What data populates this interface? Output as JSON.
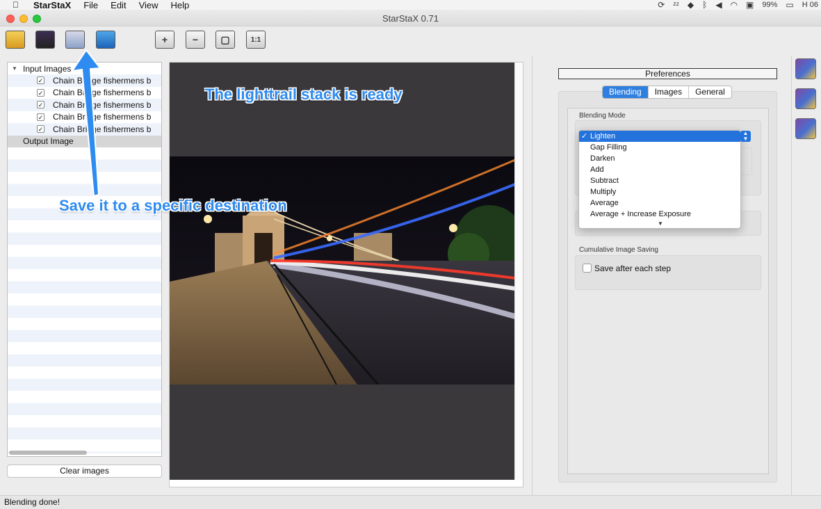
{
  "menubar": {
    "app_name": "StarStaX",
    "items": [
      "File",
      "Edit",
      "View",
      "Help"
    ],
    "battery": "99%",
    "clock": "H 06"
  },
  "window": {
    "title": "StarStaX 0.71"
  },
  "toolbar": {
    "buttons": [
      {
        "name": "open-images-button",
        "glyph": ""
      },
      {
        "name": "open-dark-frames-button",
        "glyph": ""
      },
      {
        "name": "save-image-button",
        "glyph": ""
      },
      {
        "name": "save-as-button",
        "glyph": ""
      },
      {
        "name": "zoom-in-button",
        "glyph": "+"
      },
      {
        "name": "zoom-out-button",
        "glyph": "−"
      },
      {
        "name": "fit-window-button",
        "glyph": "▢"
      },
      {
        "name": "actual-size-button",
        "glyph": "1:1"
      }
    ]
  },
  "tree": {
    "root_label": "Input Images",
    "items": [
      "Chain Bridge fishermens b",
      "Chain Bridge fishermens b",
      "Chain Bridge fishermens b",
      "Chain Bridge fishermens b",
      "Chain Bridge fishermens b"
    ],
    "output_label": "Output Image"
  },
  "clear_button": "Clear images",
  "preferences": {
    "title": "Preferences",
    "tabs": [
      "Blending",
      "Images",
      "General"
    ],
    "active_tab": "Blending",
    "blending_mode_label": "Blending Mode",
    "blending_options": [
      "Lighten",
      "Gap Filling",
      "Darken",
      "Add",
      "Subtract",
      "Multiply",
      "Average",
      "Average + Increase Exposure"
    ],
    "selected_option": "Lighten",
    "cumulative_label": "Cumulative Image Saving",
    "save_after_each_step": "Save after each step"
  },
  "status": "Blending done!",
  "annotations": {
    "ready": "The lighttrail stack is ready",
    "save": "Save it to a specific destination"
  },
  "colors": {
    "accent": "#2473dc",
    "annotation": "#2e8bf0",
    "canvas": "#3a383b"
  }
}
